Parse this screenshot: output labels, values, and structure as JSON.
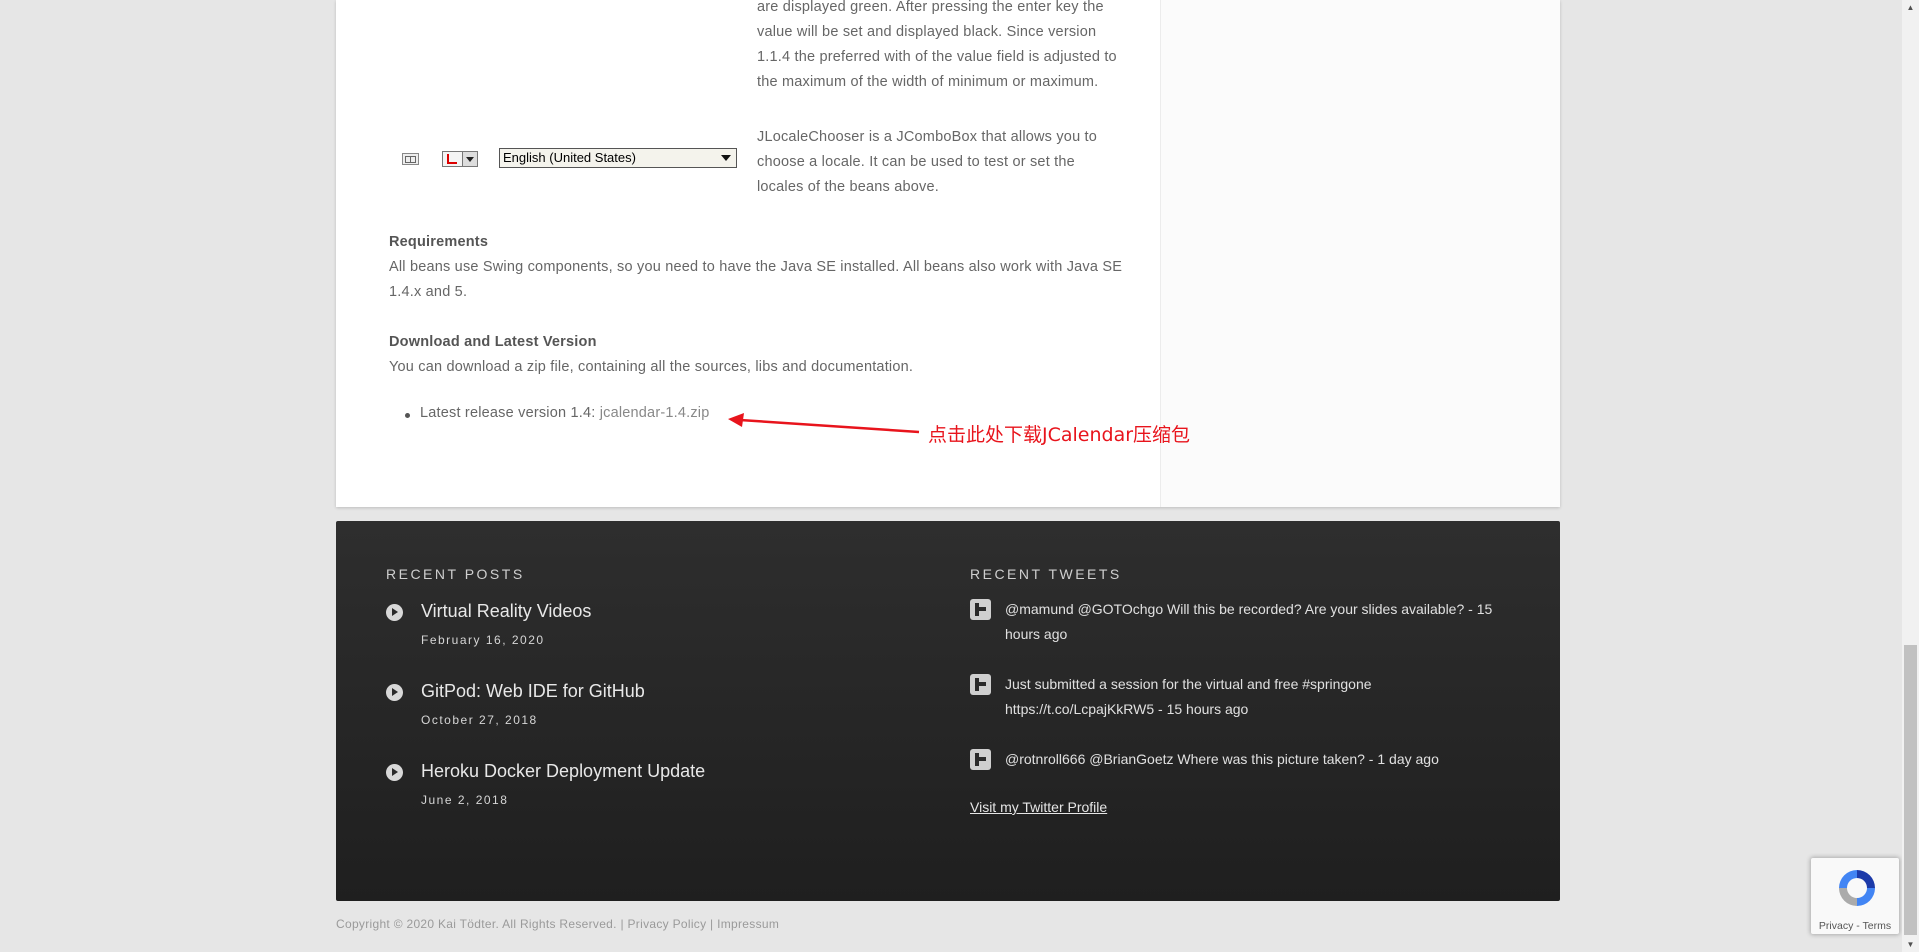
{
  "demo": {
    "partial_desc": "are displayed green. After pressing the enter key the value will be set and displayed black. Since version 1.1.4 the preferred with of the value field is adjusted to the maximum of the width of minimum or maximum.",
    "locale_combo_value": "English (United States)",
    "locale_chooser_desc": "JLocaleChooser is a JComboBox that allows you to choose a locale. It can be used to test or set the locales of the beans above."
  },
  "requirements": {
    "heading": "Requirements",
    "text": "All beans use Swing components, so you need to have the Java SE installed. All beans also work with Java SE 1.4.x and 5."
  },
  "download": {
    "heading": "Download and Latest Version",
    "text": "You can download a zip file, containing all the sources, libs and documentation.",
    "release_prefix": "Latest release version 1.4: ",
    "release_link": "jcalendar-1.4.zip"
  },
  "annotation": {
    "text": "点击此处下载JCalendar压缩包",
    "color": "#e8141c"
  },
  "footer": {
    "recent_posts_heading": "RECENT POSTS",
    "recent_tweets_heading": "RECENT TWEETS",
    "posts": [
      {
        "title": "Virtual Reality Videos",
        "date": "February 16, 2020"
      },
      {
        "title": "GitPod: Web IDE for GitHub",
        "date": "October 27, 2018"
      },
      {
        "title": "Heroku Docker Deployment Update",
        "date": "June 2, 2018"
      }
    ],
    "tweets": [
      {
        "text": "@mamund @GOTOchgo Will this be recorded? Are your slides available? - 15 hours ago"
      },
      {
        "text": "Just submitted a session for the virtual and free #springone https://t.co/LcpajKkRW5 - 15 hours ago"
      },
      {
        "text": "@rotnroll666 @BrianGoetz Where was this picture taken? - 1 day ago"
      }
    ],
    "twitter_profile_link": "Visit my Twitter Profile"
  },
  "copyright": {
    "text": "Copyright © 2020 Kai Tödter. All Rights Reserved.",
    "separator": "|",
    "privacy_link": "Privacy Policy",
    "impressum_link": "Impressum"
  },
  "recaptcha": {
    "privacy": "Privacy",
    "dash": "-",
    "terms": "Terms"
  }
}
